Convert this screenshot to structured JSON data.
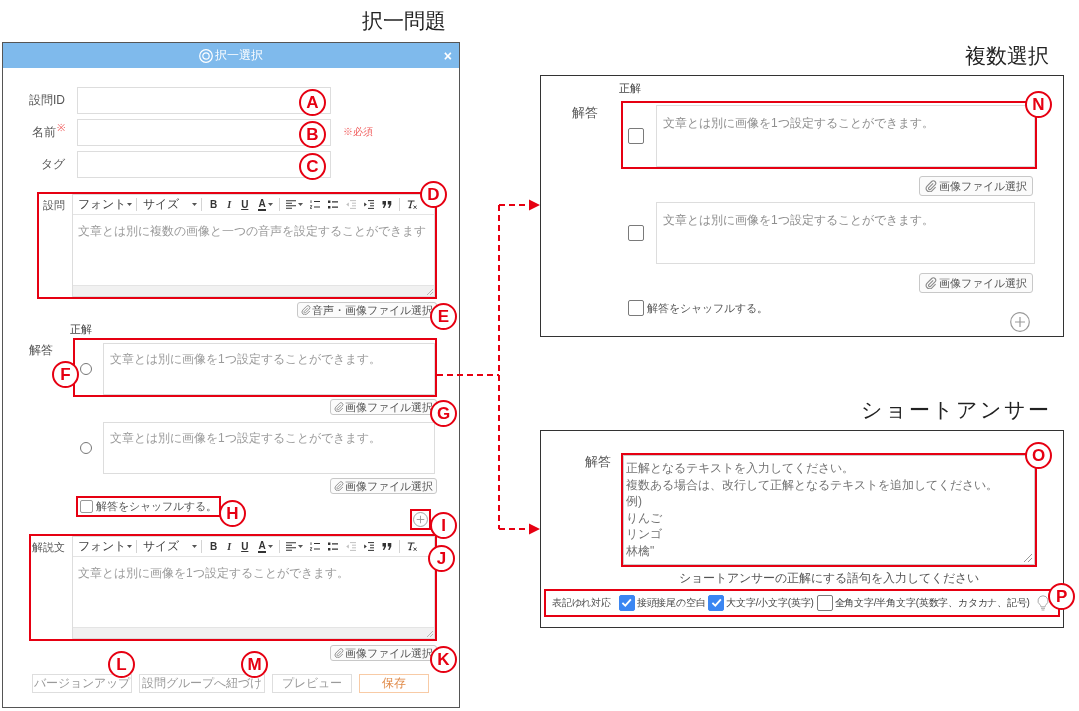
{
  "single_choice": {
    "heading": "択一問題",
    "dialog": {
      "title": "択一選択",
      "close": "×",
      "fields": [
        {
          "label": "設問ID",
          "callout": {
            "label": "A",
            "framed": false
          }
        },
        {
          "label": "名前",
          "required_mark": "※",
          "note": "※必須",
          "callout": {
            "label": "B",
            "framed": false
          }
        },
        {
          "label": "タグ",
          "callout": {
            "label": "C",
            "framed": false
          }
        }
      ],
      "question_editor": {
        "label": "設問",
        "toolbar": [
          {
            "items": [
              {
                "kind": "dropdown",
                "label": "フォント",
                "disabled": false
              }
            ]
          },
          {
            "items": [
              {
                "kind": "dropdown",
                "label": "サイズ",
                "disabled": false
              }
            ]
          },
          {
            "items": [
              {
                "kind": "bold",
                "label": "B",
                "disabled": false
              },
              {
                "kind": "italic",
                "label": "I",
                "disabled": false
              },
              {
                "kind": "underline",
                "label": "U",
                "disabled": false
              },
              {
                "kind": "color",
                "label": "A",
                "disabled": false
              }
            ]
          },
          {
            "items": [
              {
                "kind": "align",
                "disabled": false
              },
              {
                "kind": "numbered",
                "disabled": false
              },
              {
                "kind": "bulleted",
                "disabled": false
              },
              {
                "kind": "outdent",
                "disabled": true
              },
              {
                "kind": "indent",
                "disabled": false
              },
              {
                "kind": "quote",
                "disabled": false
              }
            ]
          },
          {
            "items": [
              {
                "kind": "clear",
                "disabled": false
              }
            ]
          }
        ],
        "placeholder": "文章とは別に複数の画像と一つの音声を設定することができます",
        "callout": {
          "label": "D",
          "framed": true
        }
      },
      "question_attach": {
        "label": "音声・画像ファイル選択",
        "callout": {
          "label": "E",
          "framed": false
        }
      },
      "answers": {
        "label": "解答",
        "correct_header": "正解",
        "items": [
          {
            "selected": false,
            "placeholder": "文章とは別に画像を1つ設定することができます。",
            "callout": {
              "label": "F",
              "framed": true
            },
            "attach": {
              "label": "画像ファイル選択",
              "callout": {
                "label": "G",
                "framed": false
              }
            }
          },
          {
            "selected": false,
            "placeholder": "文章とは別に画像を1つ設定することができます。",
            "attach": {
              "label": "画像ファイル選択"
            }
          }
        ]
      },
      "shuffle": {
        "label": "解答をシャッフルする。",
        "checked": false,
        "callout": {
          "label": "H",
          "framed": true
        }
      },
      "add_answer": {
        "callout": {
          "label": "I",
          "framed": true
        }
      },
      "explanation_editor": {
        "label": "解説文",
        "toolbar": [
          {
            "items": [
              {
                "kind": "dropdown",
                "label": "フォント",
                "disabled": false
              }
            ]
          },
          {
            "items": [
              {
                "kind": "dropdown",
                "label": "サイズ",
                "disabled": false
              }
            ]
          },
          {
            "items": [
              {
                "kind": "bold",
                "label": "B",
                "disabled": false
              },
              {
                "kind": "italic",
                "label": "I",
                "disabled": false
              },
              {
                "kind": "underline",
                "label": "U",
                "disabled": false
              },
              {
                "kind": "color",
                "label": "A",
                "disabled": false
              }
            ]
          },
          {
            "items": [
              {
                "kind": "align",
                "disabled": false
              },
              {
                "kind": "numbered",
                "disabled": false
              },
              {
                "kind": "bulleted",
                "disabled": false
              },
              {
                "kind": "outdent",
                "disabled": true
              },
              {
                "kind": "indent",
                "disabled": false
              },
              {
                "kind": "quote",
                "disabled": false
              }
            ]
          },
          {
            "items": [
              {
                "kind": "clear",
                "disabled": false
              }
            ]
          }
        ],
        "placeholder": "文章とは別に画像を1つ設定することができます。",
        "callout": {
          "label": "J",
          "framed": true
        }
      },
      "explanation_attach": {
        "label": "画像ファイル選択",
        "callout": {
          "label": "K",
          "framed": false
        }
      },
      "footer_buttons": [
        {
          "label": "バージョンアップ",
          "kind": "default",
          "disabled": true,
          "callout": {
            "label": "L",
            "framed": false
          }
        },
        {
          "label": "設問グループへ紐づけ",
          "kind": "default",
          "disabled": true,
          "callout": {
            "label": "M",
            "framed": false
          }
        },
        {
          "label": "プレビュー",
          "kind": "default",
          "disabled": true
        },
        {
          "label": "保存",
          "kind": "primary",
          "disabled": true
        }
      ]
    }
  },
  "multiple_choice": {
    "heading": "複数選択",
    "answers": {
      "label": "解答",
      "correct_header": "正解",
      "items": [
        {
          "checked": false,
          "placeholder": "文章とは別に画像を1つ設定することができます。",
          "callout": {
            "label": "N",
            "framed": true
          },
          "attach": {
            "label": "画像ファイル選択"
          }
        },
        {
          "checked": false,
          "placeholder": "文章とは別に画像を1つ設定することができます。",
          "attach": {
            "label": "画像ファイル選択"
          }
        }
      ]
    },
    "shuffle": {
      "label": "解答をシャッフルする。",
      "checked": false
    }
  },
  "short_answer": {
    "heading": "ショートアンサー",
    "answer": {
      "label": "解答",
      "placeholder": [
        "正解となるテキストを入力してください。",
        "複数ある場合は、改行して正解となるテキストを追加してください。",
        "例)",
        "りんご",
        "リンゴ",
        "林檎\""
      ],
      "callout": {
        "label": "O",
        "framed": true
      }
    },
    "hint": "ショートアンサーの正解にする語句を入力してください",
    "variants": {
      "label": "表記ゆれ対応",
      "options": [
        {
          "label": "接頭接尾の空白",
          "checked": true
        },
        {
          "label": "大文字/小文字(英字)",
          "checked": true
        },
        {
          "label": "全角文字/半角文字(英数字、カタカナ、記号)",
          "checked": false
        }
      ],
      "callout": {
        "label": "P",
        "framed": true
      }
    }
  }
}
